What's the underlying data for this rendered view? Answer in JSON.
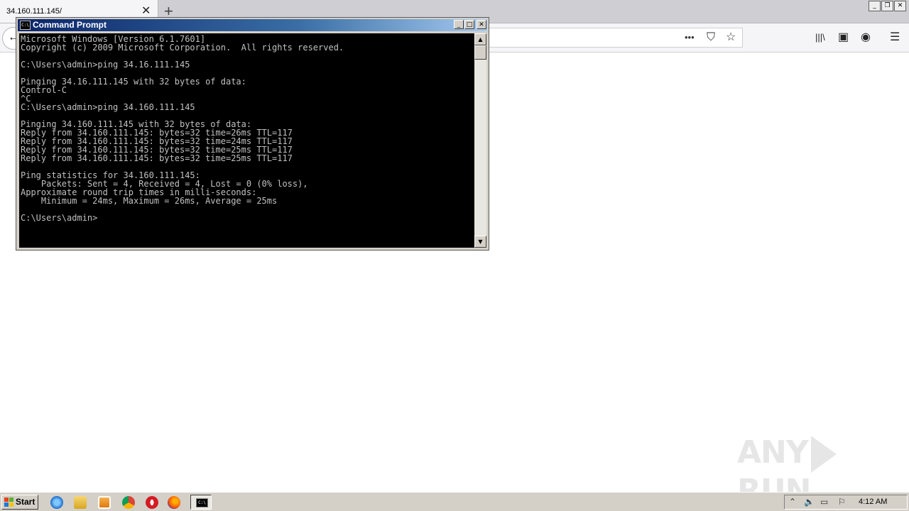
{
  "browser": {
    "tab_title": "34.160.111.145/",
    "tab_close": "✕",
    "new_tab": "+",
    "win_controls": {
      "minimize": "_",
      "restore": "❐",
      "close": "✕"
    },
    "back": "←",
    "url_icons": {
      "more": "•••",
      "pocket": "⛉",
      "bookmark": "☆"
    },
    "toolbar_icons": {
      "library": "|||\\",
      "sidebar": "▣",
      "account": "◉",
      "menu": "☰"
    }
  },
  "cmd": {
    "title": "Command Prompt",
    "icon_text": "C:\\",
    "controls": {
      "minimize": "_",
      "maximize": "□",
      "close": "✕"
    },
    "lines": [
      "Microsoft Windows [Version 6.1.7601]",
      "Copyright (c) 2009 Microsoft Corporation.  All rights reserved.",
      "",
      "C:\\Users\\admin>ping 34.16.111.145",
      "",
      "Pinging 34.16.111.145 with 32 bytes of data:",
      "Control-C",
      "^C",
      "C:\\Users\\admin>ping 34.160.111.145",
      "",
      "Pinging 34.160.111.145 with 32 bytes of data:",
      "Reply from 34.160.111.145: bytes=32 time=26ms TTL=117",
      "Reply from 34.160.111.145: bytes=32 time=24ms TTL=117",
      "Reply from 34.160.111.145: bytes=32 time=25ms TTL=117",
      "Reply from 34.160.111.145: bytes=32 time=25ms TTL=117",
      "",
      "Ping statistics for 34.160.111.145:",
      "    Packets: Sent = 4, Received = 4, Lost = 0 (0% loss),",
      "Approximate round trip times in milli-seconds:",
      "    Minimum = 24ms, Maximum = 26ms, Average = 25ms",
      "",
      "C:\\Users\\admin>"
    ],
    "scroll_up": "▲",
    "scroll_down": "▼"
  },
  "watermark": {
    "left": "ANY",
    "right": "RUN"
  },
  "taskbar": {
    "start_label": "Start",
    "task_icon_text": "C:\\",
    "tray_icons": {
      "arrow": "⌃",
      "volume": "🔈",
      "network": "▭",
      "flag": "⚐"
    },
    "clock": "4:12 AM"
  },
  "colors": {
    "titlebar_start": "#0a246a",
    "console_bg": "#000000",
    "console_text": "#c0c0c0",
    "taskbar": "#d4d0c8"
  }
}
